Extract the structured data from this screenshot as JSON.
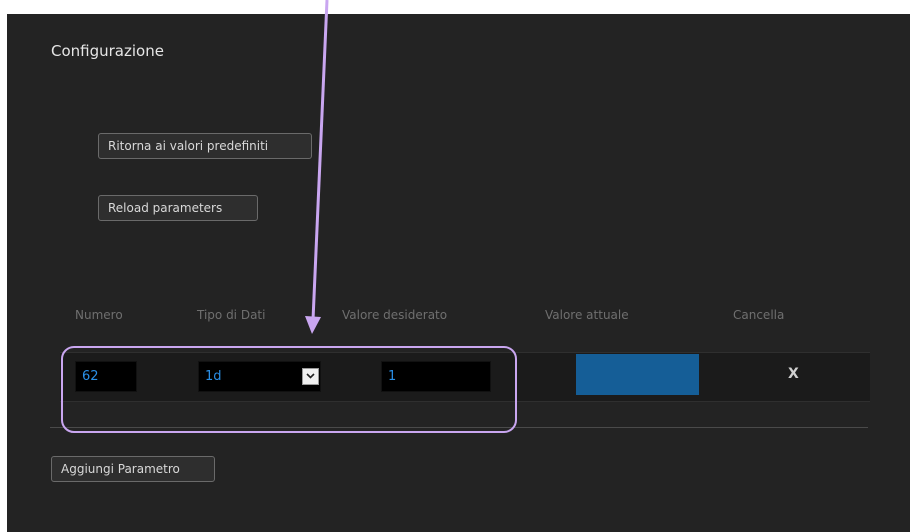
{
  "page": {
    "title": "Configurazione"
  },
  "buttons": {
    "reset_defaults": "Ritorna ai valori predefiniti",
    "reload_parameters": "Reload parameters",
    "add_parameter": "Aggiungi Parametro"
  },
  "table": {
    "headers": [
      "Numero",
      "Tipo di Dati",
      "Valore desiderato",
      "Valore attuale",
      "Cancella"
    ],
    "rows": [
      {
        "numero": "62",
        "tipo": "1d",
        "valore_desiderato": "1",
        "valore_attuale": "",
        "cancella": "X"
      }
    ]
  },
  "colors": {
    "panel_bg": "#232323",
    "input_text": "#2a8fe6",
    "value_bar": "#155e97",
    "annotation": "#c9a6f0"
  },
  "icons": {
    "dropdown": "chevron-down-icon",
    "delete": "close-icon"
  }
}
